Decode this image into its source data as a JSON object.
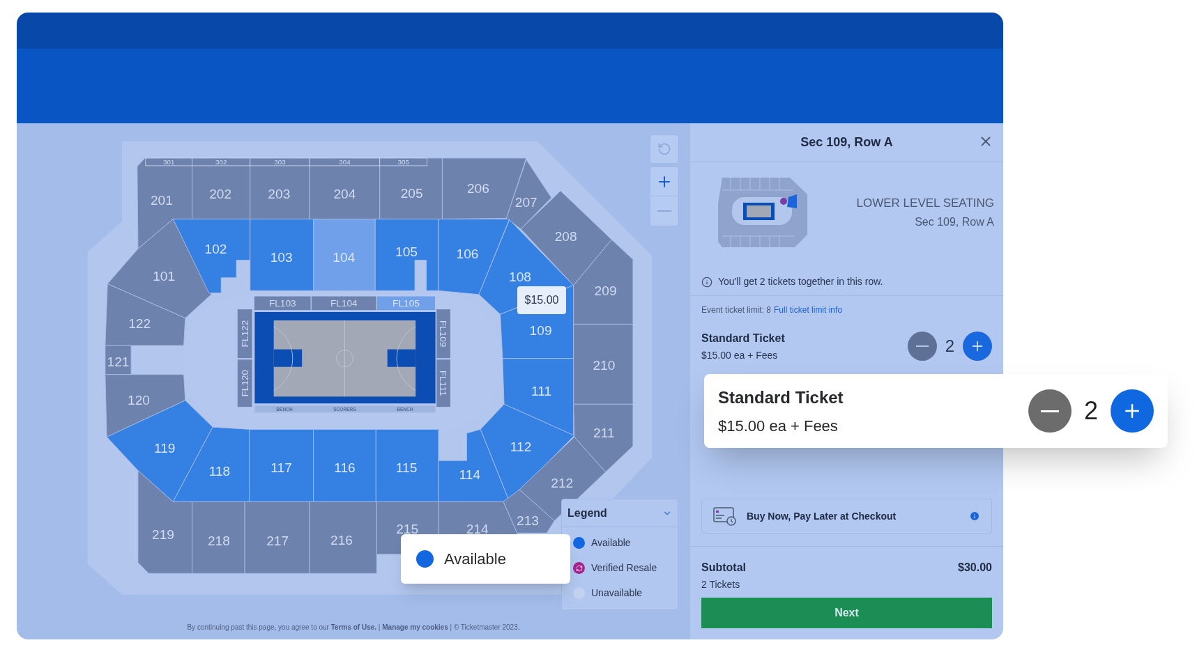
{
  "map": {
    "upper_sections": [
      "301",
      "302",
      "303",
      "304",
      "305"
    ],
    "sections": [
      {
        "label": "201",
        "available": false,
        "dimmed": false
      },
      {
        "label": "202",
        "available": false,
        "dimmed": false
      },
      {
        "label": "203",
        "available": false,
        "dimmed": false
      },
      {
        "label": "204",
        "available": false,
        "dimmed": false
      },
      {
        "label": "205",
        "available": false,
        "dimmed": false
      },
      {
        "label": "206",
        "available": false,
        "dimmed": false
      },
      {
        "label": "207",
        "available": false,
        "dimmed": false
      },
      {
        "label": "101",
        "available": false,
        "dimmed": false
      },
      {
        "label": "102",
        "available": true,
        "dimmed": false
      },
      {
        "label": "103",
        "available": true,
        "dimmed": false
      },
      {
        "label": "104",
        "available": true,
        "dimmed": true
      },
      {
        "label": "105",
        "available": true,
        "dimmed": false
      },
      {
        "label": "106",
        "available": true,
        "dimmed": false
      },
      {
        "label": "108",
        "available": true,
        "dimmed": false
      },
      {
        "label": "208",
        "available": false,
        "dimmed": false
      },
      {
        "label": "209",
        "available": false,
        "dimmed": false
      },
      {
        "label": "122",
        "available": false,
        "dimmed": false
      },
      {
        "label": "109",
        "available": true,
        "dimmed": false
      },
      {
        "label": "121",
        "available": false,
        "dimmed": false
      },
      {
        "label": "210",
        "available": false,
        "dimmed": false
      },
      {
        "label": "120",
        "available": false,
        "dimmed": false
      },
      {
        "label": "111",
        "available": true,
        "dimmed": false
      },
      {
        "label": "119",
        "available": true,
        "dimmed": false
      },
      {
        "label": "211",
        "available": false,
        "dimmed": false
      },
      {
        "label": "112",
        "available": true,
        "dimmed": false
      },
      {
        "label": "118",
        "available": true,
        "dimmed": false
      },
      {
        "label": "117",
        "available": true,
        "dimmed": false
      },
      {
        "label": "116",
        "available": true,
        "dimmed": false
      },
      {
        "label": "115",
        "available": true,
        "dimmed": false
      },
      {
        "label": "114",
        "available": true,
        "dimmed": false
      },
      {
        "label": "212",
        "available": false,
        "dimmed": false
      },
      {
        "label": "213",
        "available": false,
        "dimmed": false
      },
      {
        "label": "219",
        "available": false,
        "dimmed": false
      },
      {
        "label": "218",
        "available": false,
        "dimmed": false
      },
      {
        "label": "217",
        "available": false,
        "dimmed": false
      },
      {
        "label": "216",
        "available": false,
        "dimmed": false
      },
      {
        "label": "215",
        "available": false,
        "dimmed": false
      },
      {
        "label": "214",
        "available": false,
        "dimmed": false
      }
    ],
    "floor_sections": [
      {
        "label": "FL103",
        "available": false,
        "dimmed": false
      },
      {
        "label": "FL104",
        "available": false,
        "dimmed": false
      },
      {
        "label": "FL105",
        "available": true,
        "dimmed": true
      },
      {
        "label": "FL122",
        "available": false,
        "dimmed": false
      },
      {
        "label": "FL120",
        "available": false,
        "dimmed": false
      },
      {
        "label": "FL109",
        "available": false,
        "dimmed": false
      },
      {
        "label": "FL111",
        "available": false,
        "dimmed": false
      }
    ],
    "court_labels": [
      "BENCH",
      "SCORERS",
      "BENCH"
    ],
    "price_tooltip": "$15.00",
    "legend": {
      "title": "Legend",
      "expanded": true,
      "items": [
        {
          "label": "Available",
          "kind": "dot",
          "color": "#1266e0"
        },
        {
          "label": "Verified Resale",
          "kind": "resale",
          "color": "#a3238f"
        },
        {
          "label": "Unavailable",
          "kind": "dot",
          "color": "#c2d2ef"
        }
      ]
    },
    "footer": [
      {
        "kind": "text",
        "text": "By continuing past this page, you agree to our "
      },
      {
        "kind": "link",
        "text": "Terms of Use."
      },
      {
        "kind": "text",
        "text": " | "
      },
      {
        "kind": "link",
        "text": "Manage my cookies"
      },
      {
        "kind": "text",
        "text": " | © Ticketmaster 2023."
      }
    ]
  },
  "available_callout": {
    "label": "Available",
    "color": "#1266e0"
  },
  "panel": {
    "title": "Sec 109, Row A",
    "level_name": "LOWER LEVEL SEATING",
    "seat": "Sec 109, Row A",
    "notice": "You'll get 2 tickets together in this row.",
    "limit_text": "Event ticket limit: 8",
    "limit_link": "Full ticket limit info",
    "ticket": {
      "name": "Standard Ticket",
      "price": "$15.00 ea + Fees",
      "quantity": "2"
    },
    "pay_later": "Buy Now, Pay Later at Checkout",
    "subtotal_label": "Subtotal",
    "subtotal": "$30.00",
    "ticket_count": "2 Tickets",
    "next": "Next"
  },
  "ticket_callout": {
    "name": "Standard Ticket",
    "price": "$15.00 ea + Fees",
    "quantity": "2"
  }
}
